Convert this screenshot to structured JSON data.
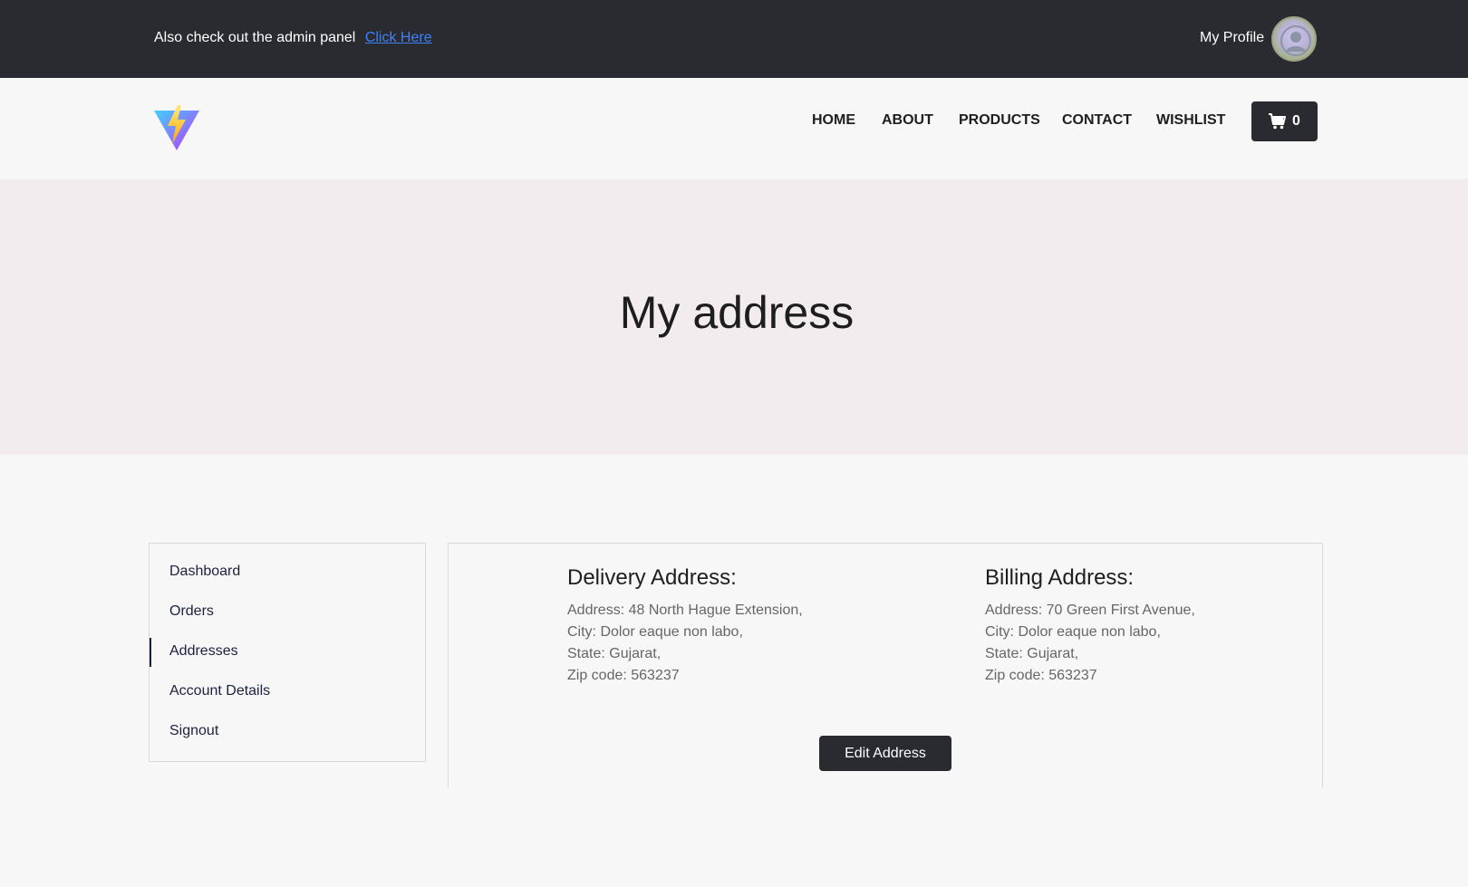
{
  "topbar": {
    "promo_text": "Also check out the admin panel",
    "promo_link": "Click Here",
    "profile_label": "My Profile"
  },
  "nav": {
    "items": [
      "HOME",
      "ABOUT",
      "PRODUCTS",
      "CONTACT",
      "WISHLIST"
    ],
    "cart_count": "0",
    "cart_icon": "shopping-cart-icon"
  },
  "hero": {
    "title": "My address"
  },
  "sidebar": {
    "items": [
      "Dashboard",
      "Orders",
      "Addresses",
      "Account Details",
      "Signout"
    ],
    "active": "Addresses"
  },
  "delivery": {
    "title": "Delivery Address:",
    "address": "Address: 48 North Hague Extension,",
    "city": "City: Dolor eaque non labo,",
    "state": "State: Gujarat,",
    "zip": "Zip code: 563237"
  },
  "billing": {
    "title": "Billing Address:",
    "address": "Address: 70 Green First Avenue,",
    "city": "City: Dolor eaque non labo,",
    "state": "State: Gujarat,",
    "zip": "Zip code: 563237"
  },
  "actions": {
    "edit_label": "Edit Address"
  },
  "colors": {
    "dark": "#2a2b30",
    "link": "#3b82ff",
    "hero_bg": "#f3ecee",
    "page_bg": "#f7f7f7"
  }
}
